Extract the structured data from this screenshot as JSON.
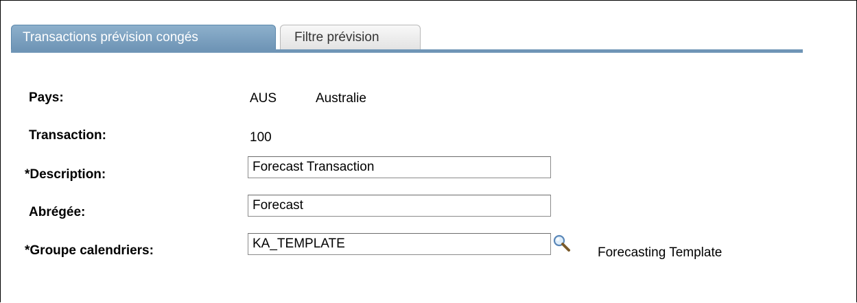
{
  "tabs": [
    {
      "label": "Transactions prévision congés",
      "active": true
    },
    {
      "label": "Filtre prévision",
      "active": false
    }
  ],
  "fields": {
    "pays": {
      "label": "Pays:",
      "code": "AUS",
      "name": "Australie"
    },
    "transaction": {
      "label": "Transaction:",
      "value": "100"
    },
    "description": {
      "label": "*Description:",
      "value": "Forecast Transaction"
    },
    "abregee": {
      "label": "Abrégée:",
      "value": "Forecast"
    },
    "groupe_calendriers": {
      "label": "*Groupe calendriers:",
      "value": "KA_TEMPLATE",
      "description": "Forecasting Template",
      "lookup_icon": "magnifier-icon"
    }
  },
  "colors": {
    "tab_active": "#7a9ebd",
    "tab_line": "#6f95b6"
  }
}
